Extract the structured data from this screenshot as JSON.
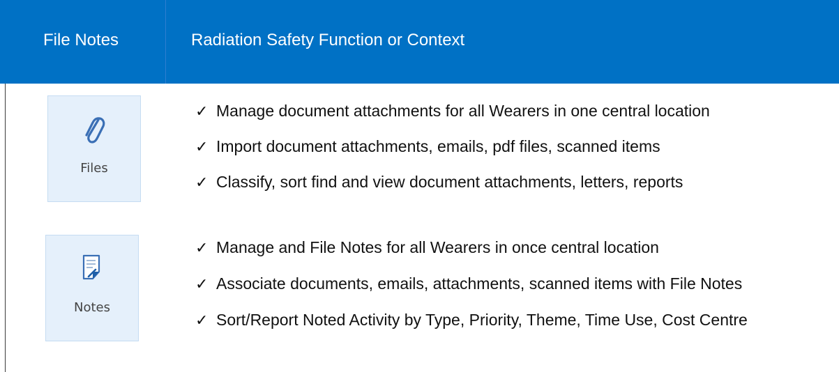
{
  "header": {
    "col1": "File Notes",
    "col2": "Radiation Safety Function or Context",
    "background": "#0071c5",
    "text_color": "#ffffff"
  },
  "rows": [
    {
      "icon": "paperclip-icon",
      "icon_label": "Files",
      "icon_color": "#3a6fb5",
      "bullets": [
        "Manage document attachments for all Wearers in one central location",
        "Import document attachments, emails, pdf files, scanned items",
        "Classify, sort find and view document attachments, letters, reports"
      ]
    },
    {
      "icon": "note-icon",
      "icon_label": "Notes",
      "icon_color": "#3a6fb5",
      "bullets": [
        "Manage and File Notes for all Wearers in once central location",
        "Associate documents, emails, attachments, scanned items with File Notes",
        "Sort/Report Noted Activity by Type, Priority, Theme, Time Use, Cost Centre"
      ]
    }
  ],
  "check_glyph": "✓",
  "icon_box_color": "#e5f0fb"
}
